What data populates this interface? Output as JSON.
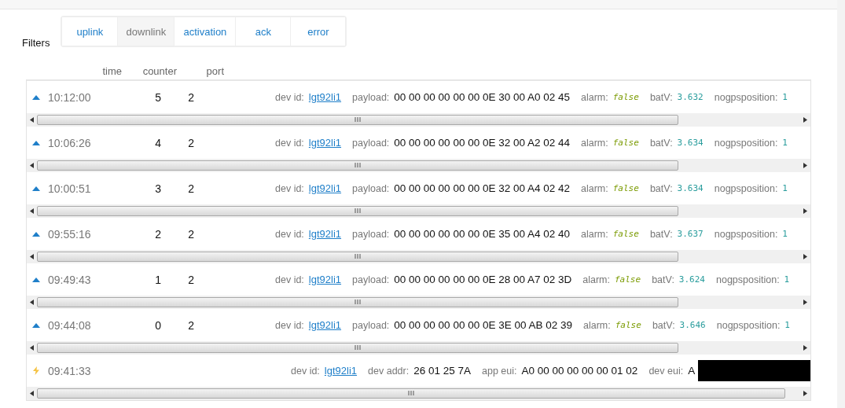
{
  "filters": {
    "label": "Filters",
    "options": [
      {
        "label": "uplink",
        "selected": false
      },
      {
        "label": "downlink",
        "selected": true
      },
      {
        "label": "activation",
        "selected": false
      },
      {
        "label": "ack",
        "selected": false
      },
      {
        "label": "error",
        "selected": false
      }
    ]
  },
  "columns": [
    "time",
    "counter",
    "port"
  ],
  "rows": [
    {
      "kind": "uplink",
      "time": "10:12:00",
      "counter": "5",
      "port": "2",
      "fields": [
        {
          "label": "dev id:",
          "value": "lgt92li1",
          "kind": "link"
        },
        {
          "label": "payload:",
          "value": "00 00 00 00 00 00 0E 30 00 A0 02 45",
          "kind": "text"
        },
        {
          "label": "alarm:",
          "value": "false",
          "kind": "bool"
        },
        {
          "label": "batV:",
          "value": "3.632",
          "kind": "number"
        },
        {
          "label": "nogpsposition:",
          "value": "1",
          "kind": "number"
        }
      ]
    },
    {
      "kind": "uplink",
      "time": "10:06:26",
      "counter": "4",
      "port": "2",
      "fields": [
        {
          "label": "dev id:",
          "value": "lgt92li1",
          "kind": "link"
        },
        {
          "label": "payload:",
          "value": "00 00 00 00 00 00 0E 32 00 A2 02 44",
          "kind": "text"
        },
        {
          "label": "alarm:",
          "value": "false",
          "kind": "bool"
        },
        {
          "label": "batV:",
          "value": "3.634",
          "kind": "number"
        },
        {
          "label": "nogpsposition:",
          "value": "1",
          "kind": "number"
        }
      ]
    },
    {
      "kind": "uplink",
      "time": "10:00:51",
      "counter": "3",
      "port": "2",
      "fields": [
        {
          "label": "dev id:",
          "value": "lgt92li1",
          "kind": "link"
        },
        {
          "label": "payload:",
          "value": "00 00 00 00 00 00 0E 32 00 A4 02 42",
          "kind": "text"
        },
        {
          "label": "alarm:",
          "value": "false",
          "kind": "bool"
        },
        {
          "label": "batV:",
          "value": "3.634",
          "kind": "number"
        },
        {
          "label": "nogpsposition:",
          "value": "1",
          "kind": "number"
        }
      ]
    },
    {
      "kind": "uplink",
      "time": "09:55:16",
      "counter": "2",
      "port": "2",
      "fields": [
        {
          "label": "dev id:",
          "value": "lgt92li1",
          "kind": "link"
        },
        {
          "label": "payload:",
          "value": "00 00 00 00 00 00 0E 35 00 A4 02 40",
          "kind": "text"
        },
        {
          "label": "alarm:",
          "value": "false",
          "kind": "bool"
        },
        {
          "label": "batV:",
          "value": "3.637",
          "kind": "number"
        },
        {
          "label": "nogpsposition:",
          "value": "1",
          "kind": "number"
        }
      ]
    },
    {
      "kind": "uplink",
      "time": "09:49:43",
      "counter": "1",
      "port": "2",
      "fields": [
        {
          "label": "dev id:",
          "value": "lgt92li1",
          "kind": "link"
        },
        {
          "label": "payload:",
          "value": "00 00 00 00 00 00 0E 28 00 A7 02 3D",
          "kind": "text"
        },
        {
          "label": "alarm:",
          "value": "false",
          "kind": "bool"
        },
        {
          "label": "batV:",
          "value": "3.624",
          "kind": "number"
        },
        {
          "label": "nogpsposition:",
          "value": "1",
          "kind": "number"
        }
      ]
    },
    {
      "kind": "uplink",
      "time": "09:44:08",
      "counter": "0",
      "port": "2",
      "fields": [
        {
          "label": "dev id:",
          "value": "lgt92li1",
          "kind": "link"
        },
        {
          "label": "payload:",
          "value": "00 00 00 00 00 00 0E 3E 00 AB 02 39",
          "kind": "text"
        },
        {
          "label": "alarm:",
          "value": "false",
          "kind": "bool"
        },
        {
          "label": "batV:",
          "value": "3.646",
          "kind": "number"
        },
        {
          "label": "nogpsposition:",
          "value": "1",
          "kind": "number"
        }
      ]
    },
    {
      "kind": "activation",
      "time": "09:41:33",
      "fields": [
        {
          "label": "dev id:",
          "value": "lgt92li1",
          "kind": "link"
        },
        {
          "label": "dev addr:",
          "value": "26 01 25 7A",
          "kind": "text"
        },
        {
          "label": "app eui:",
          "value": "A0 00 00 00 00 00 01 02",
          "kind": "text"
        },
        {
          "label": "dev eui:",
          "value": "A",
          "kind": "redacted"
        }
      ]
    }
  ]
}
